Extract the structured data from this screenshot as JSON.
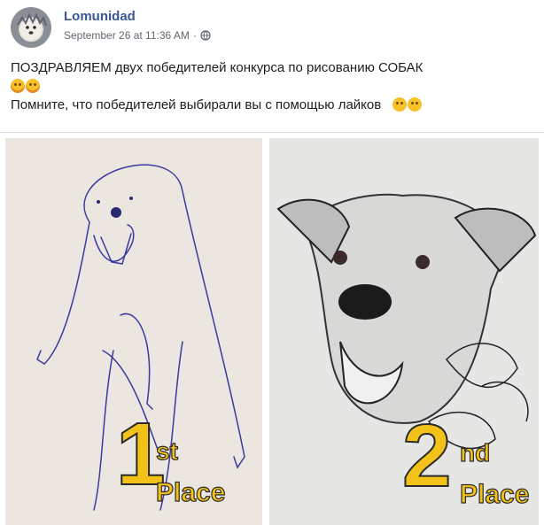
{
  "post": {
    "author": "Lomunidad",
    "timestamp": "September 26 at 11:36 AM",
    "separator": "·",
    "privacy_icon": "globe-icon",
    "line1": "ПОЗДРАВЛЯЕМ двух победителей конкурса по рисованию СОБАК",
    "line2": "Помните, что победителей выбирали вы с помощью лайков"
  },
  "images": {
    "left": {
      "number": "1",
      "suffix": "st",
      "place": "Place"
    },
    "right": {
      "number": "2",
      "suffix": "nd",
      "place": "Place"
    }
  },
  "colors": {
    "author": "#385898",
    "meta": "#606770",
    "place_fill": "#f2c218"
  }
}
